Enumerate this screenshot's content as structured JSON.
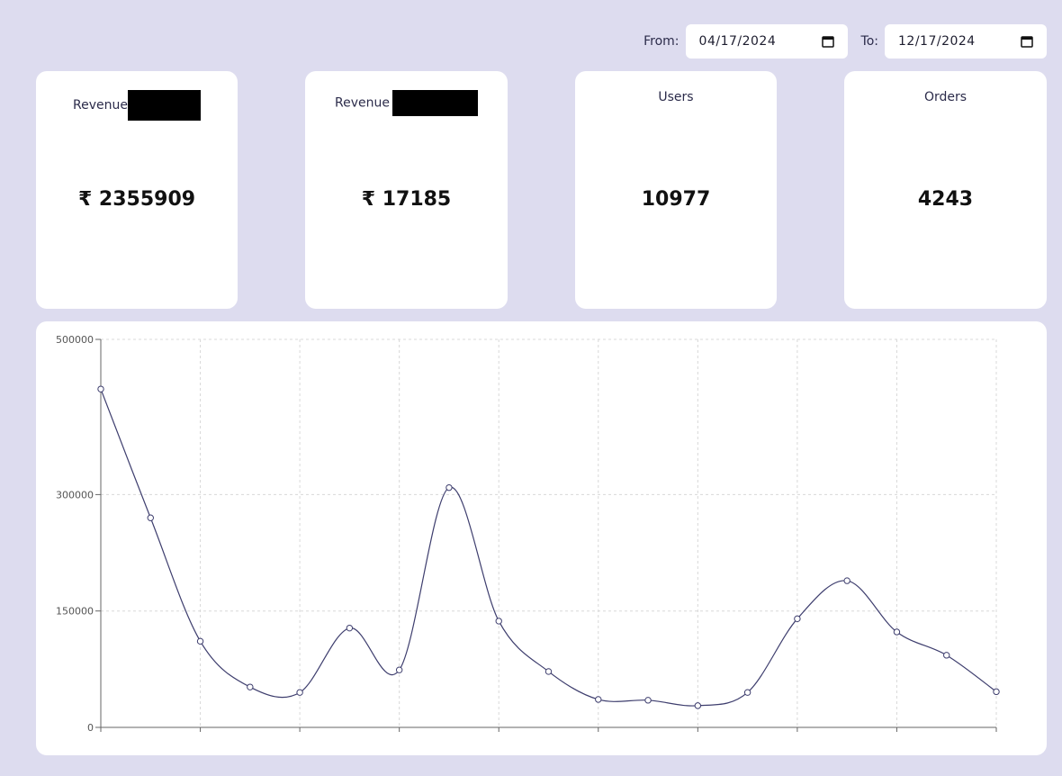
{
  "filters": {
    "from_label": "From:",
    "from_value": "04/17/2024",
    "to_label": "To:",
    "to_value": "12/17/2024",
    "calendar_icon": "calendar-icon"
  },
  "cards": [
    {
      "title": "Revenue",
      "value": "₹ 2355909",
      "redacted": true
    },
    {
      "title": "Revenue",
      "value": "₹ 17185",
      "redacted": true
    },
    {
      "title": "Users",
      "value": "10977",
      "redacted": false
    },
    {
      "title": "Orders",
      "value": "4243",
      "redacted": false
    }
  ],
  "chart_data": {
    "type": "line",
    "y_tick_labels": [
      "0",
      "150000",
      "300000",
      "500000"
    ],
    "ylim": [
      0,
      500000
    ],
    "grid": true,
    "x_categories_count": 19,
    "series": [
      {
        "color": "#3e3e6e",
        "values": [
          436000,
          270000,
          111000,
          52000,
          45000,
          128000,
          74000,
          309000,
          137000,
          72000,
          36000,
          35000,
          28000,
          45000,
          140000,
          189000,
          123000,
          93000,
          46000
        ]
      }
    ]
  }
}
